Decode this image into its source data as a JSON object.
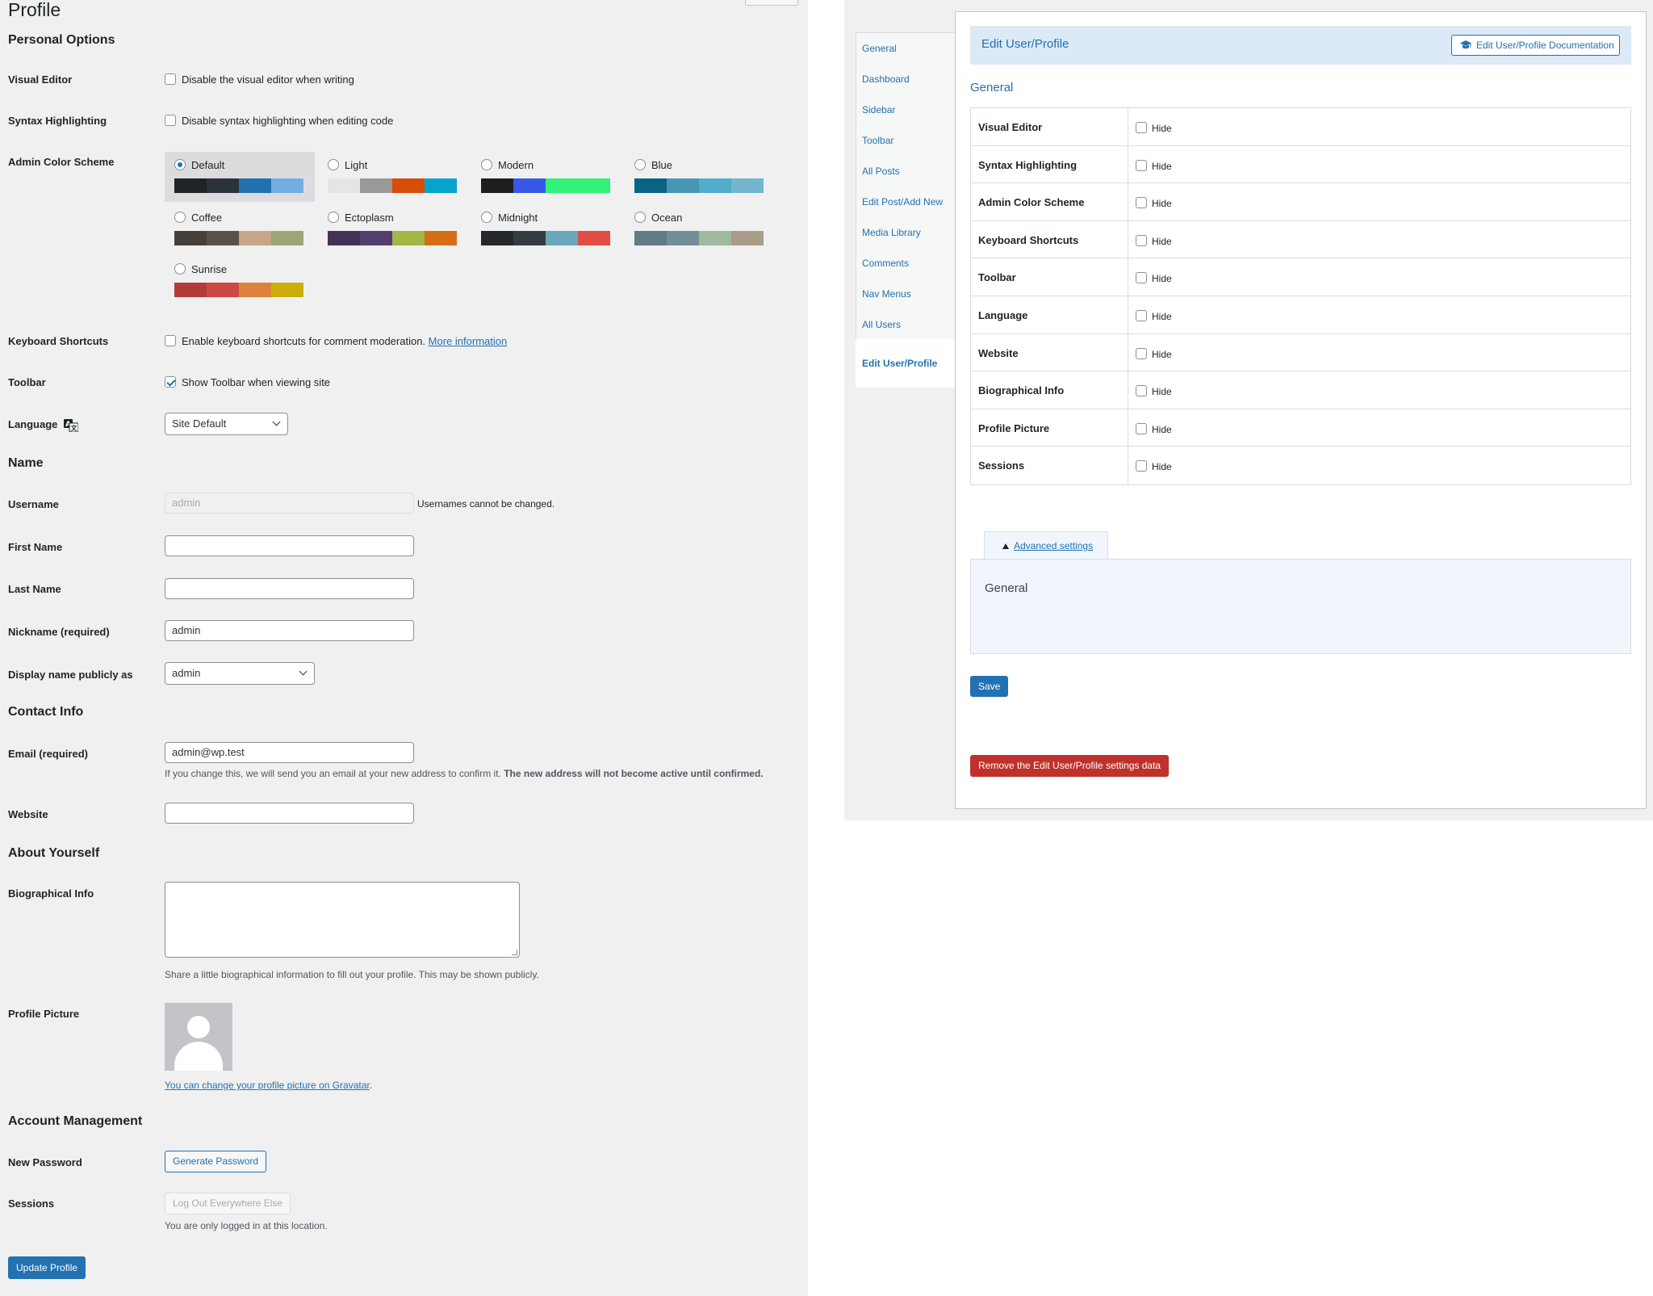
{
  "left": {
    "page_title": "Profile",
    "personal_options": {
      "heading": "Personal Options",
      "visual_editor": {
        "label": "Visual Editor",
        "checkbox_text": "Disable the visual editor when writing",
        "checked": false
      },
      "syntax": {
        "label": "Syntax Highlighting",
        "checkbox_text": "Disable syntax highlighting when editing code",
        "checked": false
      },
      "color_scheme": {
        "label": "Admin Color Scheme",
        "schemes": [
          {
            "name": "Default",
            "selected": true,
            "colors": [
              "#1d2327",
              "#2c3338",
              "#2271b1",
              "#72aee6"
            ]
          },
          {
            "name": "Light",
            "selected": false,
            "colors": [
              "#e5e5e5",
              "#999999",
              "#d64e07",
              "#04a4cc"
            ]
          },
          {
            "name": "Modern",
            "selected": false,
            "colors": [
              "#1e1e1e",
              "#3858e9",
              "#33f078",
              "#33f078"
            ]
          },
          {
            "name": "Blue",
            "selected": false,
            "colors": [
              "#096484",
              "#4796b3",
              "#52accc",
              "#74b6ce"
            ]
          },
          {
            "name": "Coffee",
            "selected": false,
            "colors": [
              "#46403c",
              "#59524c",
              "#c7a589",
              "#9ea476"
            ]
          },
          {
            "name": "Ectoplasm",
            "selected": false,
            "colors": [
              "#413256",
              "#523f6d",
              "#a3b745",
              "#d46f15"
            ]
          },
          {
            "name": "Midnight",
            "selected": false,
            "colors": [
              "#25282b",
              "#363b3f",
              "#69a8bb",
              "#e14d43"
            ]
          },
          {
            "name": "Ocean",
            "selected": false,
            "colors": [
              "#627c83",
              "#738e96",
              "#9ebaa0",
              "#aa9d88"
            ]
          },
          {
            "name": "Sunrise",
            "selected": false,
            "colors": [
              "#b43c38",
              "#cf4944",
              "#dd823b",
              "#ccaf0b"
            ]
          }
        ]
      },
      "keyboard": {
        "label": "Keyboard Shortcuts",
        "checkbox_text": "Enable keyboard shortcuts for comment moderation.",
        "link": "More information",
        "checked": false
      },
      "toolbar": {
        "label": "Toolbar",
        "checkbox_text": "Show Toolbar when viewing site",
        "checked": true
      },
      "language": {
        "label": "Language",
        "value": "Site Default"
      }
    },
    "name": {
      "heading": "Name",
      "username": {
        "label": "Username",
        "value": "admin",
        "note": "Usernames cannot be changed."
      },
      "first_name": {
        "label": "First Name",
        "value": ""
      },
      "last_name": {
        "label": "Last Name",
        "value": ""
      },
      "nickname": {
        "label": "Nickname (required)",
        "value": "admin"
      },
      "display_name": {
        "label": "Display name publicly as",
        "value": "admin"
      }
    },
    "contact": {
      "heading": "Contact Info",
      "email": {
        "label": "Email (required)",
        "value": "admin@wp.test",
        "note_normal": "If you change this, we will send you an email at your new address to confirm it. ",
        "note_bold": "The new address will not become active until confirmed."
      },
      "website": {
        "label": "Website",
        "value": ""
      }
    },
    "about": {
      "heading": "About Yourself",
      "bio": {
        "label": "Biographical Info",
        "note": "Share a little biographical information to fill out your profile. This may be shown publicly."
      },
      "picture": {
        "label": "Profile Picture",
        "link": "You can change your profile picture on Gravatar",
        "link_suffix": "."
      }
    },
    "account": {
      "heading": "Account Management",
      "new_password": {
        "label": "New Password",
        "button": "Generate Password"
      },
      "sessions": {
        "label": "Sessions",
        "button": "Log Out Everywhere Else",
        "note": "You are only logged in at this location."
      }
    },
    "update_button": "Update Profile"
  },
  "right": {
    "tabs": [
      "General",
      "Dashboard",
      "Sidebar",
      "Toolbar",
      "All Posts",
      "Edit Post/Add New",
      "Media Library",
      "Comments",
      "Nav Menus",
      "All Users",
      "Edit User/Profile"
    ],
    "active_tab": "Edit User/Profile",
    "header_title": "Edit User/Profile",
    "doc_button": "Edit User/Profile Documentation",
    "section_title": "General",
    "rows": [
      {
        "label": "Visual Editor",
        "option": "Hide"
      },
      {
        "label": "Syntax Highlighting",
        "option": "Hide"
      },
      {
        "label": "Admin Color Scheme",
        "option": "Hide"
      },
      {
        "label": "Keyboard Shortcuts",
        "option": "Hide"
      },
      {
        "label": "Toolbar",
        "option": "Hide"
      },
      {
        "label": "Language",
        "option": "Hide"
      },
      {
        "label": "Website",
        "option": "Hide"
      },
      {
        "label": "Biographical Info",
        "option": "Hide"
      },
      {
        "label": "Profile Picture",
        "option": "Hide"
      },
      {
        "label": "Sessions",
        "option": "Hide"
      }
    ],
    "advanced_link": "Advanced settings",
    "advanced_section": "General",
    "save_button": "Save",
    "remove_button": "Remove the Edit User/Profile settings data"
  },
  "colors": {
    "accent": "#2271b1",
    "danger": "#c0312b",
    "header_bg": "#dbeaf6",
    "admin_bg": "#f0f0f1"
  }
}
